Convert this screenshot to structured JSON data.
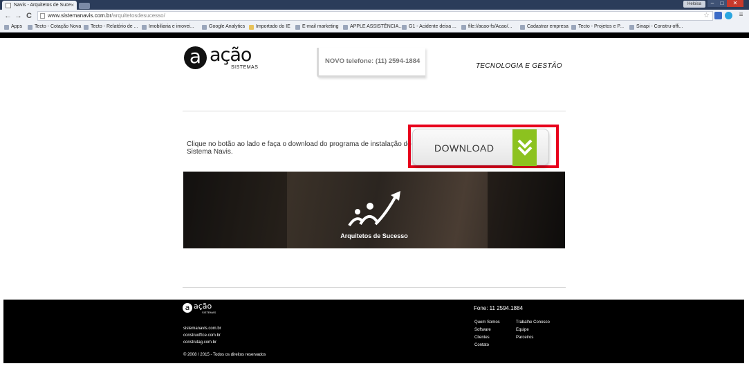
{
  "browser": {
    "tab_title": "Navis - Arquitetos de Suce",
    "tab_close": "×",
    "user_name": "Heloisa",
    "win_min": "–",
    "win_max": "□",
    "win_close": "✕",
    "url_host": "www.sistemanavis.com.br",
    "url_path": "/arquitetosdesucesso/",
    "back": "←",
    "forward": "→",
    "reload": "C",
    "star": "☆",
    "bookmarks": [
      {
        "label": "Apps"
      },
      {
        "label": "Tecto - Cotação Nova"
      },
      {
        "label": "Tecto - Relatório de ..."
      },
      {
        "label": "Imobiliaria e imovei..."
      },
      {
        "label": "Google Analytics"
      },
      {
        "label": "Importado do IE"
      },
      {
        "label": "E-mail marketing"
      },
      {
        "label": "APPLE ASSISTÊNCIA..."
      },
      {
        "label": "G1 - Acidente deixa ..."
      },
      {
        "label": "file://acao-fs/Acao/..."
      },
      {
        "label": "Cadastrar empresa"
      },
      {
        "label": "Tecto - Projetos e P..."
      },
      {
        "label": "Sinapi - Constru-offi..."
      }
    ]
  },
  "header": {
    "logo_letter": "a",
    "logo_word": "ação",
    "logo_sub": "SISTEMAS",
    "phone": "NOVO telefone: (11) 2594-1884",
    "tagline": "TECNOLOGIA E GESTÃO"
  },
  "main": {
    "instructions": "Clique no botão ao lado e faça o download do programa de instalação do Sistema Navis.",
    "download_label": "DOWNLOAD",
    "banner_title": "Arquitetos de Sucesso"
  },
  "footer": {
    "logo_letter": "a",
    "logo_word": "ação",
    "logo_sub": "SISTEMAS",
    "links": [
      "sistemanavis.com.br",
      "construoffice.com.br",
      "construtag.com.br"
    ],
    "copyright": "© 2008 / 2015 - Todos os direitos reservados",
    "phone": "Fone:  11 2594.1884",
    "menu_col1": [
      "Quem Somos",
      "Software",
      "Clientes",
      "Contato"
    ],
    "menu_col2": [
      "Trabalhe Conosco",
      "Equipe",
      "Parceiros"
    ]
  },
  "colors": {
    "highlight": "#e8001c",
    "download_accent": "#8cc21f",
    "footer_bg": "#000000"
  }
}
